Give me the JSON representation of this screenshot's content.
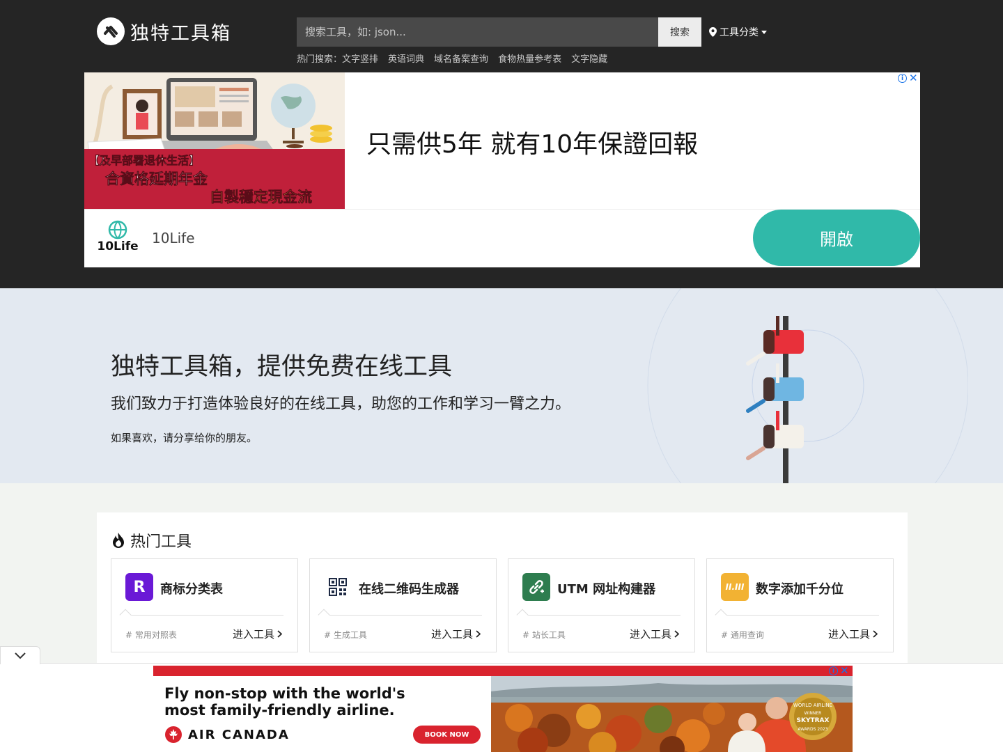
{
  "header": {
    "logo_text": "独特工具箱",
    "search_placeholder": "搜索工具，如: json...",
    "search_button": "搜索",
    "category_label": "工具分类",
    "hot_search_label": "热门搜索：",
    "hot_search_items": [
      "文字竖排",
      "英语词典",
      "域名备案查询",
      "食物热量参考表",
      "文字隐藏"
    ]
  },
  "ad_top": {
    "image_text_1": "【及早部署退休生活】",
    "image_text_2": "合資格延期年金",
    "image_text_3": "自製穩定現金流",
    "headline": "只需供5年 就有10年保證回報",
    "brand_logo_text": "10Life",
    "brand_name": "10Life",
    "open_button": "開啟"
  },
  "hero": {
    "title": "独特工具箱，提供免费在线工具",
    "subtitle": "我们致力于打造体验良好的在线工具，助您的工作和学习一臂之力。",
    "note": "如果喜欢，请分享给你的朋友。"
  },
  "hot_tools": {
    "title": "热门工具",
    "enter_label": "进入工具",
    "cards": [
      {
        "name": "商标分类表",
        "tag": "# 常用对照表",
        "icon": "R",
        "color": "#6a19d6"
      },
      {
        "name": "在线二维码生成器",
        "tag": "# 生成工具",
        "icon": "qr-code-icon",
        "color": "#ffffff"
      },
      {
        "name": "UTM 网址构建器",
        "tag": "# 站长工具",
        "icon": "link-icon",
        "color": "#2e7d4f"
      },
      {
        "name": "数字添加千分位",
        "tag": "# 通用查询",
        "icon": "II.III",
        "color": "#f2b233"
      }
    ]
  },
  "ad_bottom": {
    "headline": "Fly non-stop with the world's most family-friendly airline.",
    "brand": "AIR CANADA",
    "book_button": "BOOK NOW",
    "badge_line_1": "WORLD AIRLINE",
    "badge_line_2": "WINNER",
    "badge_line_3": "SKYTRAX",
    "badge_line_4": "AWARDS 2023"
  }
}
